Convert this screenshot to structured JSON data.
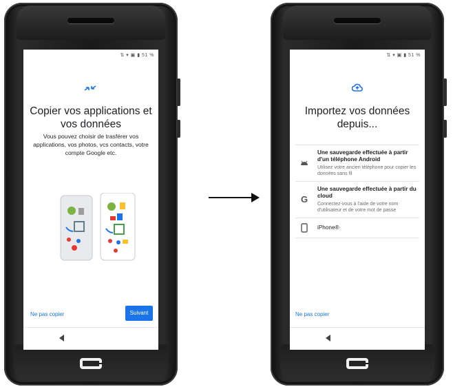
{
  "left_screen": {
    "status": "⇅ ▾ ▣ ▮ 51 %",
    "icon": "transfer-arrows-icon",
    "title": "Copier vos applications et vos données",
    "description": "Vous pouvez choisir de trasférer vos applications, vos photos, vcs contacts, votre compte Google etc.",
    "illustration": "two-phones-transfer-illustration",
    "skip_link": "Ne pas copier",
    "next_button": "Suivant"
  },
  "right_screen": {
    "status": "⇅ ▾ ▣ ▮ 51 %",
    "icon": "cloud-upload-icon",
    "title": "Importez vos données depuis...",
    "options": [
      {
        "icon": "android-icon",
        "title": "Une sauvegarde effectuée à partir d'un téléphone Android",
        "subtitle": "Utilisez votre ancien téléphone pour copier les données sans fil"
      },
      {
        "icon": "google-g-icon",
        "title": "Une sauvegarde effectuée à partir du cloud",
        "subtitle": "Connectez-vous à l'aide de votre nom d'utilisateur et de votre mot de passe"
      },
      {
        "icon": "phone-outline-icon",
        "title": "iPhone®",
        "subtitle": ""
      }
    ],
    "skip_link": "Ne pas copier"
  },
  "colors": {
    "accent": "#1a73e8",
    "phone_body": "#1c1c1c"
  }
}
